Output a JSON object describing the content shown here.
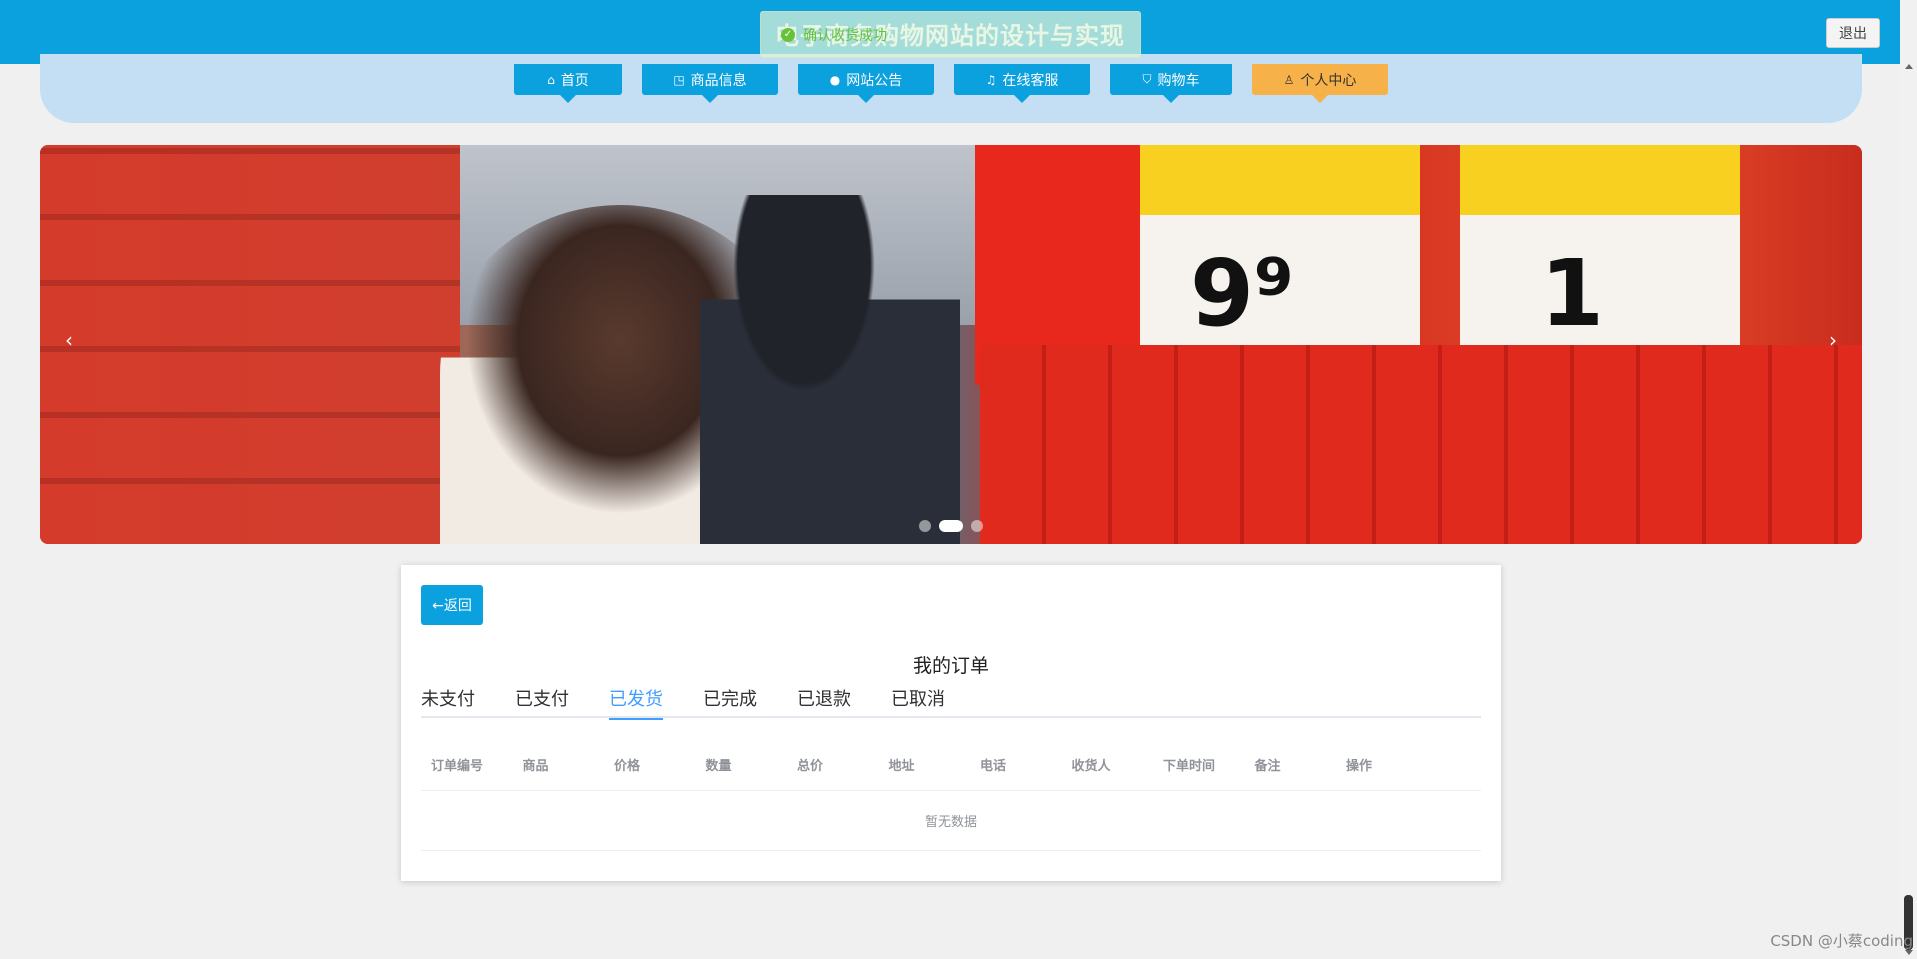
{
  "header": {
    "title": "电子商务购物网站的设计与实现",
    "logout_label": "退出"
  },
  "toast": {
    "icon": "check-circle-icon",
    "message": "确认收货成功"
  },
  "nav": {
    "items": [
      {
        "label": "首页",
        "icon": "home-icon",
        "glyph": "⌂"
      },
      {
        "label": "商品信息",
        "icon": "bag-icon",
        "glyph": "◳"
      },
      {
        "label": "网站公告",
        "icon": "notice-icon",
        "glyph": "●"
      },
      {
        "label": "在线客服",
        "icon": "headset-icon",
        "glyph": "♫"
      },
      {
        "label": "购物车",
        "icon": "cart-icon",
        "glyph": "⛉"
      },
      {
        "label": "个人中心",
        "icon": "user-icon",
        "glyph": "♙"
      }
    ],
    "active_index": 5
  },
  "banner": {
    "prev_glyph": "‹",
    "next_glyph": "›",
    "slide_count": 3,
    "active_slide": 1,
    "price_1": "9⁹",
    "price_2": "1"
  },
  "orders": {
    "back_label": "←返回",
    "title": "我的订单",
    "tabs": [
      "未支付",
      "已支付",
      "已发货",
      "已完成",
      "已退款",
      "已取消"
    ],
    "active_tab": 2,
    "columns": [
      "订单编号",
      "商品",
      "价格",
      "数量",
      "总价",
      "地址",
      "电话",
      "收货人",
      "下单时间",
      "备注",
      "操作"
    ],
    "empty_text": "暂无数据"
  },
  "watermark": "CSDN @小蔡coding"
}
